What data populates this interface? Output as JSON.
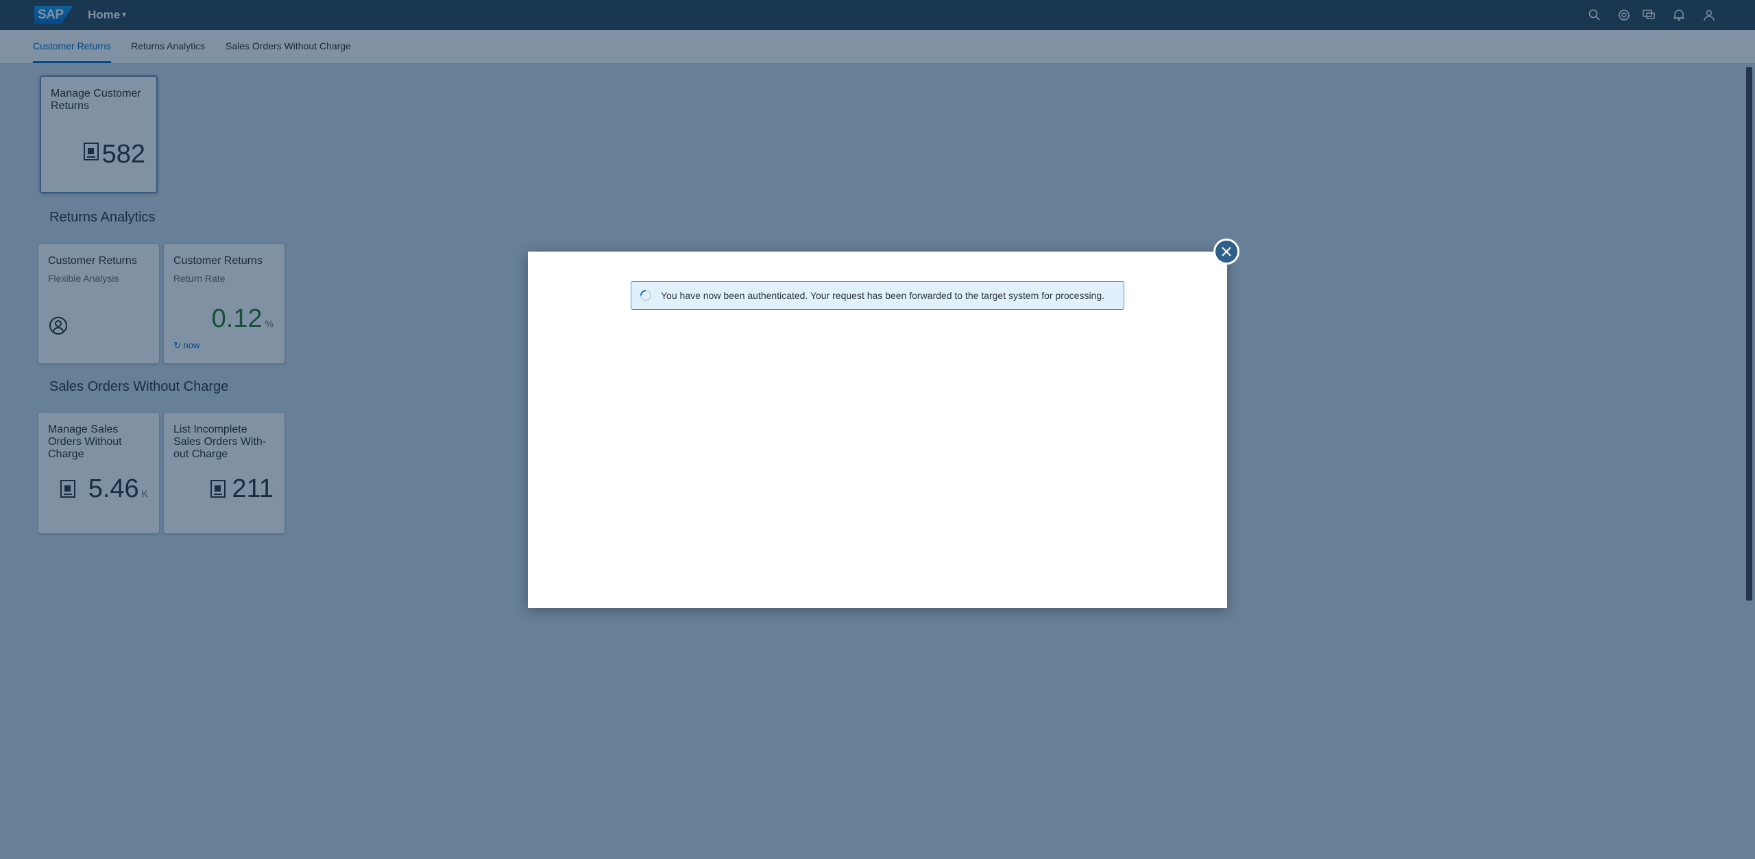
{
  "shell": {
    "logo_text": "SAP",
    "title": "Home",
    "icons": [
      "search-icon",
      "help-icon",
      "feedback-icon",
      "notification-icon",
      "user-icon"
    ]
  },
  "anchors": [
    {
      "label": "Customer Returns",
      "active": true
    },
    {
      "label": "Returns Analytics",
      "active": false
    },
    {
      "label": "Sales Orders Without Charge",
      "active": false
    }
  ],
  "groups": {
    "returns_analytics": "Returns Analytics",
    "sales_orders": "Sales Orders Without Charge"
  },
  "tiles": {
    "manage_returns": {
      "title": "Manage Customer Returns",
      "value": "582"
    },
    "flexible_analysis": {
      "title": "Customer Returns",
      "subtitle": "Flexible Analysis"
    },
    "return_rate": {
      "title": "Customer Returns",
      "subtitle": "Return Rate",
      "value": "0.12",
      "unit": "%",
      "refresh": "now"
    },
    "manage_sales_orders": {
      "title": "Manage Sales Orders Without Charge",
      "value": "5.46",
      "unit": "K"
    },
    "incomplete_sales_orders": {
      "title": "List Incomplete Sales Orders With-out Charge",
      "value": "211"
    }
  },
  "dialog": {
    "message": "You have now been authenticated. Your request has been forwarded to the target system for processing."
  },
  "colors": {
    "shell_bg": "#354a5f",
    "accent": "#0a6ed1",
    "info_border": "#2a9ad9",
    "info_bg": "#e1f1fb"
  }
}
